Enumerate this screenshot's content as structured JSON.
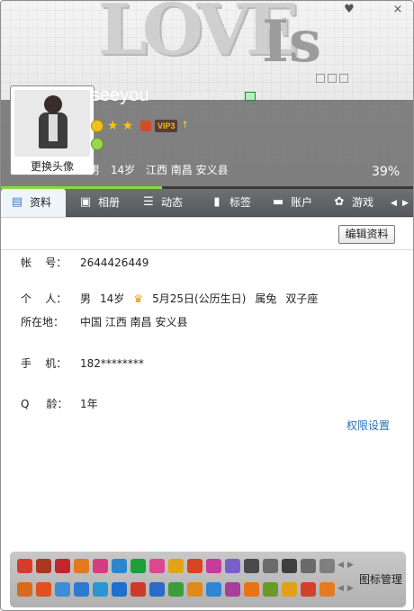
{
  "window": {
    "skin_icon": "skin-icon",
    "close_icon": "close-icon",
    "skin_glyph": "♥",
    "close_glyph": "×"
  },
  "header": {
    "decor_text": "LOVE",
    "decor_text2": "Is",
    "change_avatar": "更换头像",
    "nickname": "seeyou",
    "qq_number": "2644426449",
    "vip_label": "VIP3",
    "gender": "男",
    "age": "14岁",
    "location": "江西 南昌 安义县",
    "completion": "39%",
    "completion_value": 0.39
  },
  "tabs": [
    {
      "label": "资料",
      "icon": "card-icon",
      "glyph": "▤"
    },
    {
      "label": "相册",
      "icon": "album-icon",
      "glyph": "▣"
    },
    {
      "label": "动态",
      "icon": "feed-icon",
      "glyph": "☰"
    },
    {
      "label": "标签",
      "icon": "bookmark-icon",
      "glyph": "▮"
    },
    {
      "label": "账户",
      "icon": "wallet-icon",
      "glyph": "▬"
    },
    {
      "label": "游戏",
      "icon": "game-icon",
      "glyph": "✿"
    }
  ],
  "content": {
    "edit_button": "编辑资料",
    "rows": [
      {
        "label": "帐    号：",
        "values": [
          "2644426449"
        ]
      },
      {
        "label": "个    人：",
        "values": [
          "男",
          "14岁",
          "5月25日(公历生日)",
          "属兔",
          "双子座"
        ]
      },
      {
        "label": "所在地：",
        "values": [
          "中国 江西 南昌 安义县"
        ]
      },
      {
        "label": "手    机：",
        "values": [
          "182********"
        ]
      },
      {
        "label": "Q     龄：",
        "values": [
          "1年"
        ]
      }
    ],
    "permission_link": "权限设置"
  },
  "footer": {
    "manage_label": "图标管理",
    "icon_colors_row1": [
      "#d83b2a",
      "#a8381e",
      "#c0262c",
      "#e07a1f",
      "#d63c80",
      "#2e85c7",
      "#1e9e3a",
      "#d94a8c",
      "#e3a21a",
      "#d7441f",
      "#c63b9c",
      "#7a5fc9",
      "#4a4a4a",
      "#6b6b6b",
      "#3f3f3f",
      "#6a6a6a",
      "#7f7f7f"
    ],
    "icon_colors_row2": [
      "#d96a1e",
      "#e0511f",
      "#3b8fd6",
      "#2d7bd0",
      "#2a96d2",
      "#1f6fcf",
      "#d03a2a",
      "#2c6bc7",
      "#3b9e3a",
      "#e0891c",
      "#2f86d3",
      "#a83f9c",
      "#e87417",
      "#6a9a2a",
      "#e49f1a",
      "#d3412c",
      "#e57b20"
    ]
  }
}
